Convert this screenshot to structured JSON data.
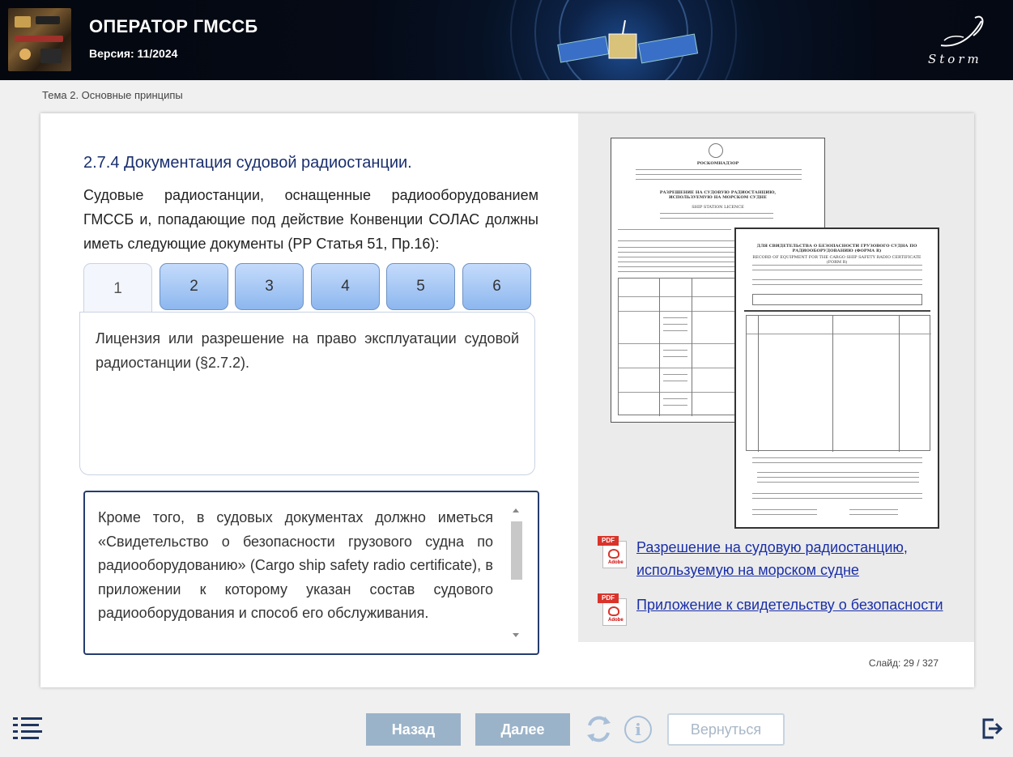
{
  "header": {
    "title": "ОПЕРАТОР ГМССБ",
    "version": "Версия: 11/2024",
    "logo_text": "Storm"
  },
  "breadcrumb": "Тема 2. Основные принципы",
  "content": {
    "section_title": "2.7.4 Документация судовой радиостанции.",
    "intro": "Судовые радиостанции, оснащенные радиооборудованием ГМССБ и, попадающие под действие Конвенции СОЛАС должны иметь следующие документы (РР Статья 51, Пр.16):",
    "tabs": [
      {
        "label": "1",
        "active": true
      },
      {
        "label": "2",
        "active": false
      },
      {
        "label": "3",
        "active": false
      },
      {
        "label": "4",
        "active": false
      },
      {
        "label": "5",
        "active": false
      },
      {
        "label": "6",
        "active": false
      }
    ],
    "tab_content": "Лицензия или разрешение на право эксплуатации судовой радиостанции (§2.7.2).",
    "scroll_text": "Кроме того, в судовых документах должно иметься «Свидетельство о безопасности грузового судна по радиооборудованию» (Cargo ship safety radio certificate), в приложении к которому указан состав судового радиооборудования и способ его обслуживания."
  },
  "documents": {
    "doc1_org": "РОСКОМНАДЗОР",
    "doc1_title": "РАЗРЕШЕНИЕ НА СУДОВУЮ РАДИОСТАНЦИЮ, ИСПОЛЬЗУЕМУЮ НА МОРСКОМ СУДНЕ",
    "doc1_subtitle": "SHIP STATION LICENCE",
    "doc2_title": "ДЛЯ СВИДЕТЕЛЬСТВА О БЕЗОПАСНОСТИ ГРУЗОВОГО СУДНА ПО РАДИООБОРУДОВАНИЮ (ФОРМА R)",
    "doc2_subtitle": "RECORD OF EQUIPMENT FOR THE CARGO SHIP SAFETY RADIO CERTIFICATE (FORM R)"
  },
  "links": [
    {
      "icon": "pdf-icon",
      "text": "Разрешение на судовую радиостанцию, используемую на морском судне"
    },
    {
      "icon": "pdf-icon",
      "text": "Приложение к свидетельству о безопасности"
    }
  ],
  "pdf_icon_label": "PDF",
  "pdf_icon_brand": "Adobe",
  "slide": {
    "label": "Слайд:",
    "current": "29",
    "total": "327",
    "display": "Слайд:  29 / 327"
  },
  "footer": {
    "back": "Назад",
    "next": "Далее",
    "return": "Вернуться",
    "info_glyph": "i"
  },
  "colors": {
    "accent": "#1a2f6e",
    "tab_gradient_top": "#c4dbfb",
    "tab_gradient_bottom": "#8db7ef",
    "button_disabled": "#9bb3c9",
    "link": "#1a2fa8"
  }
}
